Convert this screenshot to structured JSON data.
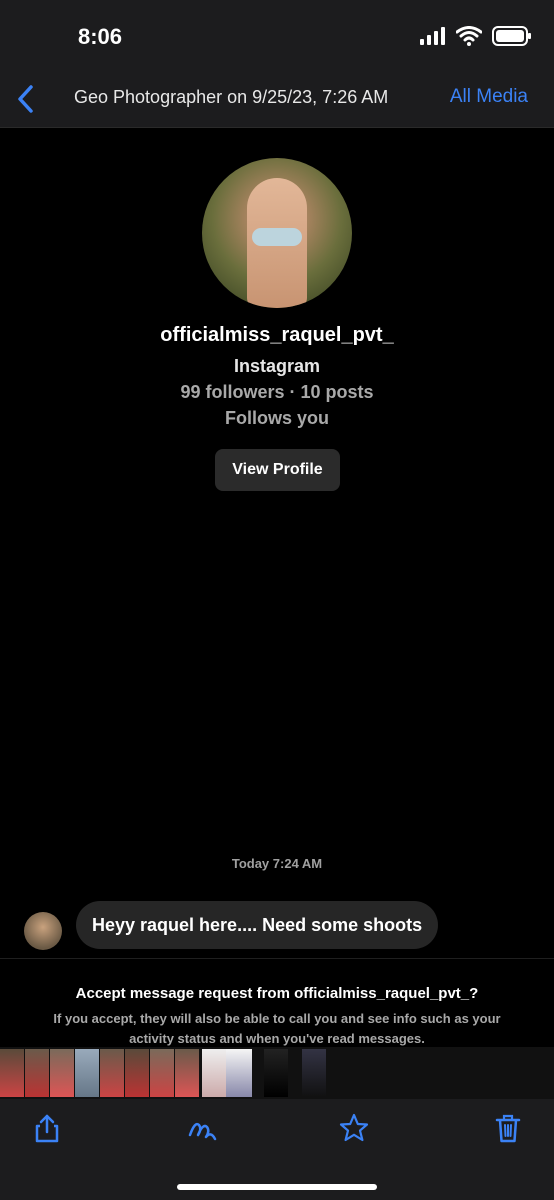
{
  "status": {
    "time": "8:06"
  },
  "nav": {
    "title": "Geo Photographer on 9/25/23, 7:26 AM",
    "all_media": "All Media"
  },
  "profile": {
    "username": "officialmiss_raquel_pvt_",
    "platform": "Instagram",
    "stats": "99 followers · 10 posts",
    "follows": "Follows you",
    "view_profile_label": "View Profile"
  },
  "chat": {
    "timestamp": "Today 7:24 AM",
    "message": "Heyy raquel here.... Need some shoots"
  },
  "request": {
    "title_prefix": "Accept message request from ",
    "title_user": "officialmiss_raquel_pvt_",
    "title_suffix": "?",
    "description": "If you accept, they will also be able to call you and see info such as your activity status and when you've read messages."
  },
  "toolbar": {
    "icons": [
      "share-icon",
      "markup-icon",
      "favorite-icon",
      "trash-icon"
    ]
  },
  "colors": {
    "accent": "#3b82f6",
    "background": "#000000",
    "bar": "#1c1c1e"
  }
}
